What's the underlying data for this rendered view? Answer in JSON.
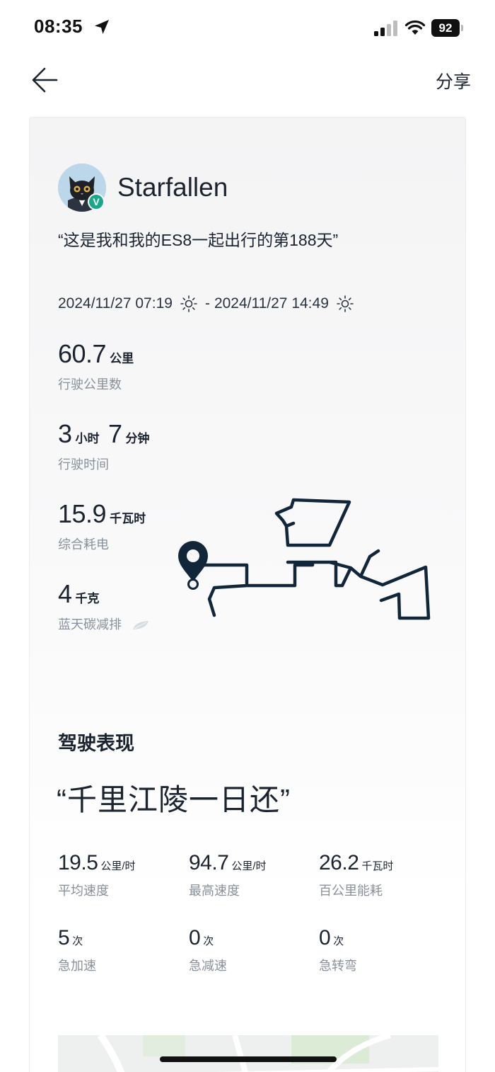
{
  "status_bar": {
    "time": "08:35",
    "battery": "92"
  },
  "nav": {
    "share_label": "分享"
  },
  "profile": {
    "username": "Starfallen",
    "badge": "V"
  },
  "quote": "“这是我和我的ES8一起出行的第188天”",
  "trip": {
    "start": "2024/11/27 07:19",
    "separator": "-",
    "end": "2024/11/27 14:49"
  },
  "stats": {
    "distance": {
      "value": "60.7",
      "unit": "公里",
      "label": "行驶公里数"
    },
    "duration": {
      "hours": "3",
      "hours_unit": "小时",
      "minutes": "7",
      "minutes_unit": "分钟",
      "label": "行驶时间"
    },
    "energy": {
      "value": "15.9",
      "unit": "千瓦时",
      "label": "综合耗电"
    },
    "carbon": {
      "value": "4",
      "unit": "千克",
      "label": "蓝天碳减排"
    }
  },
  "performance": {
    "title": "驾驶表现",
    "slogan": "“千里江陵一日还”",
    "metrics": [
      {
        "value": "19.5",
        "unit": "公里/时",
        "label": "平均速度"
      },
      {
        "value": "94.7",
        "unit": "公里/时",
        "label": "最高速度"
      },
      {
        "value": "26.2",
        "unit": "千瓦时",
        "label": "百公里能耗"
      },
      {
        "value": "5",
        "unit": "次",
        "label": "急加速"
      },
      {
        "value": "0",
        "unit": "次",
        "label": "急减速"
      },
      {
        "value": "0",
        "unit": "次",
        "label": "急转弯"
      }
    ]
  },
  "icons": {
    "back": "arrow-left-icon",
    "location": "location-arrow-icon",
    "sun": "sun-icon",
    "leaf": "leaf-icon",
    "pin": "map-pin-icon"
  },
  "colors": {
    "route": "#12263a",
    "badge": "#1aa88d",
    "label": "#8a909a"
  }
}
